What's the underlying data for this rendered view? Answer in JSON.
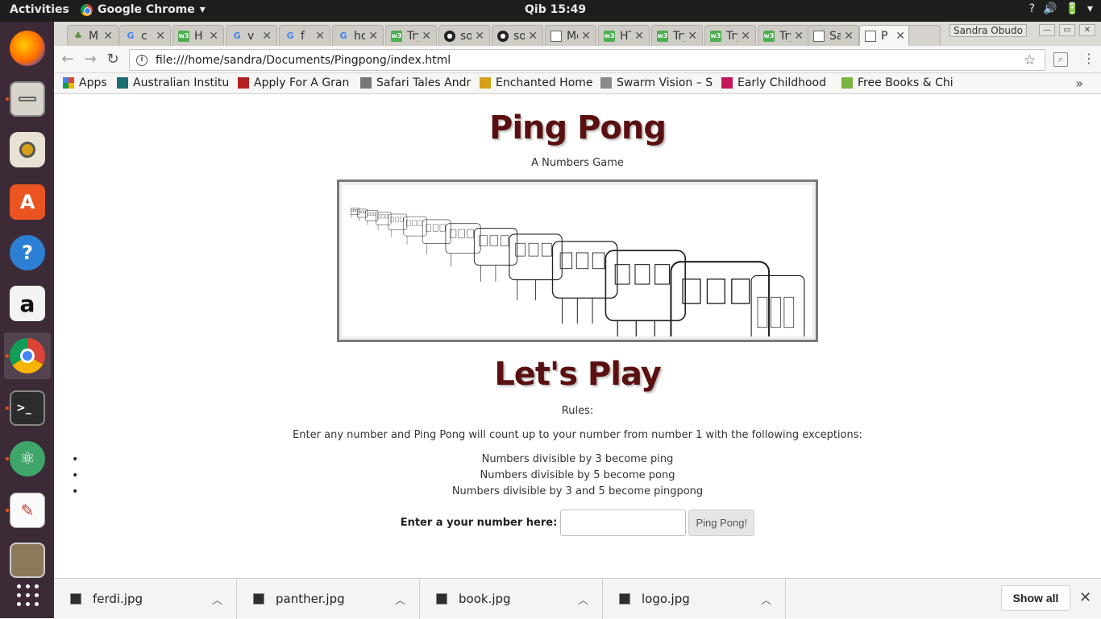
{
  "topbar": {
    "activities": "Activities",
    "app_name": "Google Chrome",
    "clock": "Qib 15:49",
    "tray": [
      "?",
      "🔊",
      "🔋",
      "▾"
    ]
  },
  "launcher": {
    "items": [
      "Firefox",
      "Files",
      "Rhythmbox",
      "Ubuntu Software",
      "Help",
      "Amazon",
      "Google Chrome",
      "Terminal",
      "Atom",
      "Text Editor",
      "Photos",
      "Show Applications"
    ]
  },
  "tabs": [
    {
      "title": "M",
      "icon": "leaf-icon"
    },
    {
      "title": "c",
      "icon": "google-icon"
    },
    {
      "title": "H",
      "icon": "w3-icon"
    },
    {
      "title": "v",
      "icon": "google-icon"
    },
    {
      "title": "f",
      "icon": "google-icon"
    },
    {
      "title": "hov",
      "icon": "google-icon"
    },
    {
      "title": "Tryi",
      "icon": "w3-icon"
    },
    {
      "title": "sob",
      "icon": "github-icon"
    },
    {
      "title": "sob",
      "icon": "github-icon"
    },
    {
      "title": "Mov",
      "icon": "page-icon"
    },
    {
      "title": "HTM",
      "icon": "w3-icon"
    },
    {
      "title": "Tryi",
      "icon": "w3-icon"
    },
    {
      "title": "Tryi",
      "icon": "w3-icon"
    },
    {
      "title": "Tryi",
      "icon": "w3-icon"
    },
    {
      "title": "San",
      "icon": "page-icon"
    },
    {
      "title": "P",
      "icon": "page-icon"
    }
  ],
  "window": {
    "user": "Sandra Obudo"
  },
  "toolbar": {
    "url": "file:///home/sandra/Documents/Pingpong/index.html"
  },
  "bookmarks": {
    "items": [
      {
        "label": "Apps",
        "color": "#4285f4"
      },
      {
        "label": "Australian Institu",
        "color": "#1b6e6e"
      },
      {
        "label": "Apply For A Gran",
        "color": "#b22222"
      },
      {
        "label": "Safari Tales Andr",
        "color": "#777777"
      },
      {
        "label": "Enchanted Home",
        "color": "#d4a017"
      },
      {
        "label": "Swarm Vision – S",
        "color": "#8a8a8a"
      },
      {
        "label": "Early Childhood",
        "color": "#c2185b"
      },
      {
        "label": "Free Books & Chi",
        "color": "#7cb342"
      }
    ],
    "more": "»"
  },
  "page": {
    "title": "Ping Pong",
    "subtitle": "A Numbers Game",
    "section_title": "Let's Play",
    "rules_label": "Rules:",
    "rules_intro": "Enter any number and Ping Pong will count up to your number from number 1 with the following exceptions:",
    "rules": [
      "Numbers divisible by 3 become ping",
      "Numbers divisible by 5 become pong",
      "Numbers divisible by 3 and 5 become pingpong"
    ],
    "input_label": "Enter a your number here:",
    "input_value": "",
    "submit_label": "Ping Pong!"
  },
  "downloads": {
    "files": [
      "ferdi.jpg",
      "panther.jpg",
      "book.jpg",
      "logo.jpg"
    ],
    "show_all": "Show all"
  }
}
